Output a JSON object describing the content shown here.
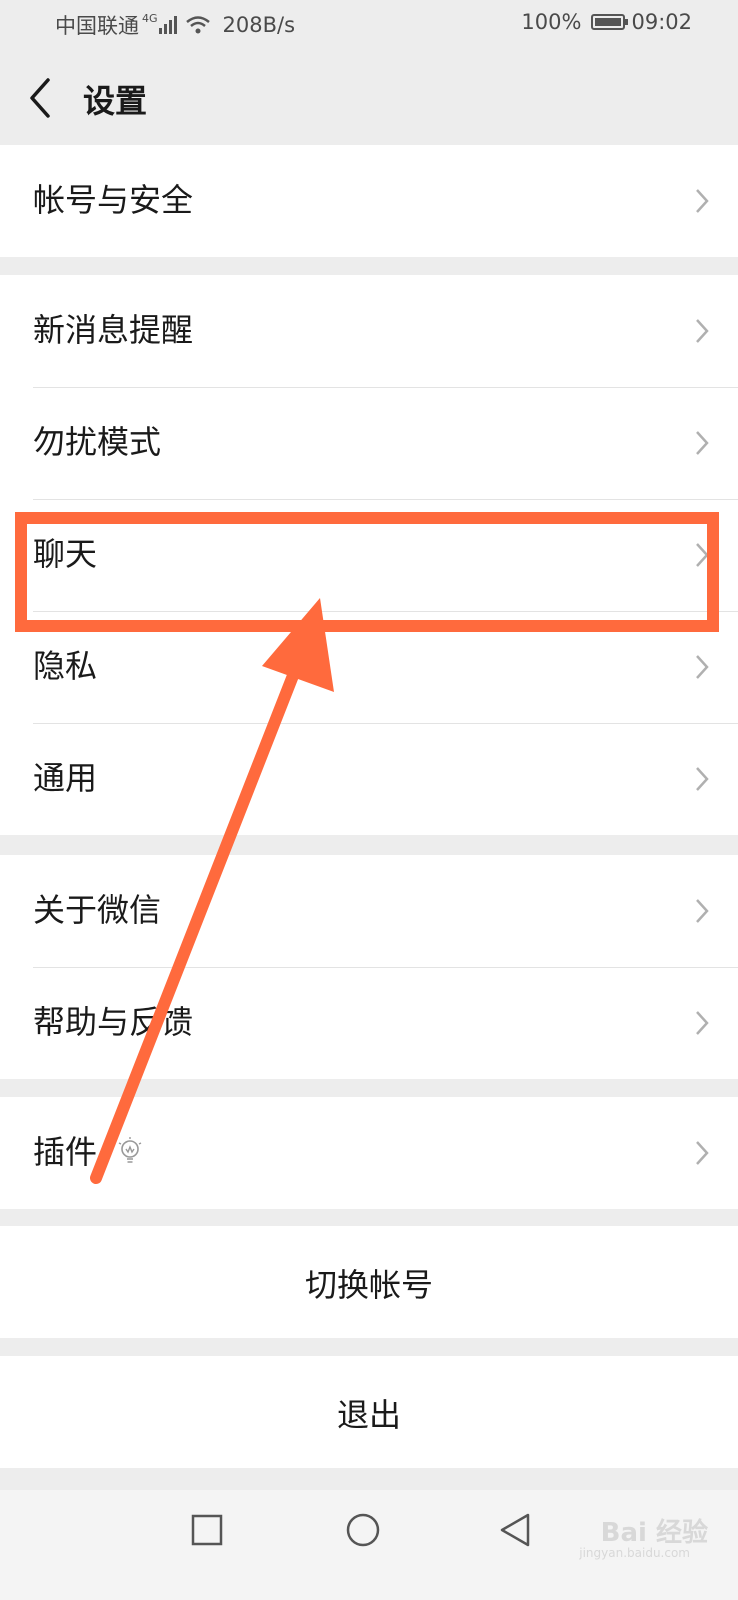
{
  "status_bar": {
    "carrier": "中国联通",
    "network": "4G",
    "speed": "208B/s",
    "battery": "100%",
    "time": "09:02"
  },
  "header": {
    "title": "设置",
    "back_icon": "chevron-left-icon"
  },
  "groups": [
    {
      "items": [
        {
          "label": "帐号与安全"
        }
      ]
    },
    {
      "items": [
        {
          "label": "新消息提醒"
        },
        {
          "label": "勿扰模式"
        },
        {
          "label": "聊天"
        },
        {
          "label": "隐私"
        },
        {
          "label": "通用"
        }
      ]
    },
    {
      "items": [
        {
          "label": "关于微信"
        },
        {
          "label": "帮助与反馈"
        }
      ]
    },
    {
      "items": [
        {
          "label": "插件",
          "icon": "lightbulb-icon"
        }
      ]
    }
  ],
  "buttons": {
    "switch_account": "切换帐号",
    "logout": "退出"
  },
  "navbar": {
    "square_icon": "recent-apps-icon",
    "circle_icon": "home-icon",
    "triangle_icon": "back-triangle-icon"
  },
  "annotation": {
    "highlighted_item": "聊天",
    "color": "#ff6a3d"
  },
  "watermark": {
    "text": "Bai 经验",
    "sub": "jingyan.baidu.com"
  }
}
